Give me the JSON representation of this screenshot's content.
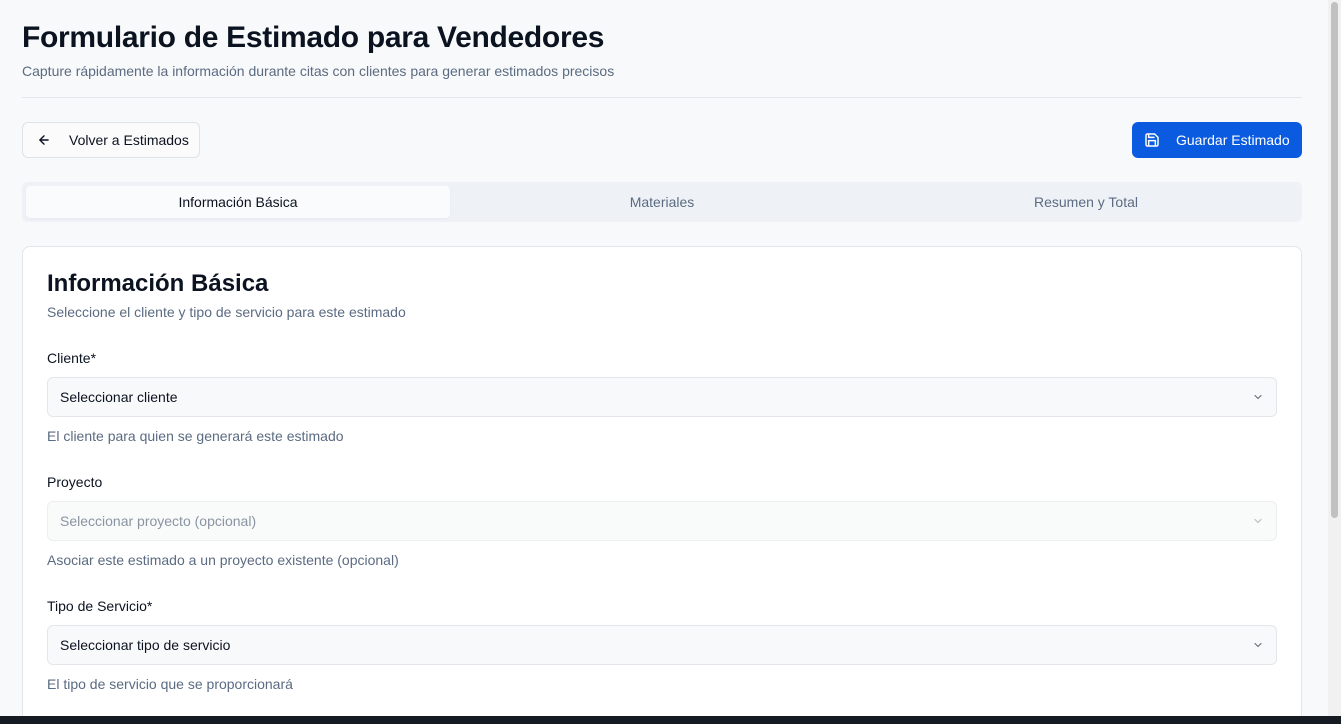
{
  "header": {
    "title": "Formulario de Estimado para Vendedores",
    "subtitle": "Capture rápidamente la información durante citas con clientes para generar estimados precisos"
  },
  "actions": {
    "back_label": "Volver a Estimados",
    "back_icon": "arrow-left-icon",
    "save_label": "Guardar Estimado",
    "save_icon": "save-icon",
    "accent_color": "#0a5be0"
  },
  "tabs": [
    {
      "label": "Información Básica",
      "active": true
    },
    {
      "label": "Materiales",
      "active": false
    },
    {
      "label": "Resumen y Total",
      "active": false
    }
  ],
  "card": {
    "title": "Información Básica",
    "subtitle": "Seleccione el cliente y tipo de servicio para este estimado",
    "fields": [
      {
        "label": "Cliente*",
        "value": "Seleccionar cliente",
        "help": "El cliente para quien se generará este estimado",
        "disabled": false
      },
      {
        "label": "Proyecto",
        "value": "Seleccionar proyecto (opcional)",
        "help": "Asociar este estimado a un proyecto existente (opcional)",
        "disabled": true
      },
      {
        "label": "Tipo de Servicio*",
        "value": "Seleccionar tipo de servicio",
        "help": "El tipo de servicio que se proporcionará",
        "disabled": false
      }
    ]
  }
}
